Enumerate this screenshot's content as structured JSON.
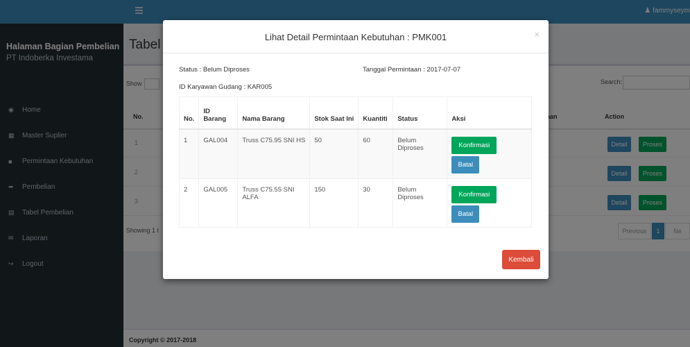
{
  "header": {
    "user": " fammyseym"
  },
  "sidebar": {
    "title": "Halaman Bagian Pembelian",
    "subtitle": "PT Indoberka Investama",
    "items": [
      {
        "label": "Home",
        "icon": "dashboard-icon"
      },
      {
        "label": "Master Suplier",
        "icon": "grid-icon"
      },
      {
        "label": "Permintaan Kebutuhan",
        "icon": "folder-icon"
      },
      {
        "label": "Pembelian",
        "icon": "share-icon"
      },
      {
        "label": "Tabel Pembelian",
        "icon": "table-icon"
      },
      {
        "label": "Laporan",
        "icon": "envelope-icon"
      },
      {
        "label": "Logout",
        "icon": "logout-icon"
      }
    ]
  },
  "content": {
    "page_title": "Tabel P",
    "show_label": "Show",
    "search_label": "Search:",
    "col_no": "No.",
    "col_aan": "aan",
    "col_action": "Action",
    "rows": [
      "1",
      "2",
      "3"
    ],
    "detail_label": "Detail",
    "proses_label": "Proses",
    "showing": "Showing 1 t",
    "prev_label": "Previous",
    "page_1": "1",
    "next_label": "Ne"
  },
  "footer": {
    "text": "Copyright © 2017-2018"
  },
  "modal": {
    "title": "Lihat Detail Permintaan Kebutuhan : PMK001",
    "close": "×",
    "status": "Status : Belum Diproses",
    "date": "Tanggal Permintaan : 2017-07-07",
    "karyawan": "ID Karyawan Gudang : KAR005",
    "columns": [
      "No.",
      "ID Barang",
      "Nama Barang",
      "Stok Saat Ini",
      "Kuantiti",
      "Status",
      "Aksi"
    ],
    "rows": [
      {
        "no": "1",
        "id": "GAL004",
        "nama": "Truss C75.95 SNI HS",
        "stok": "50",
        "kuantiti": "60",
        "status": "Belum Diproses"
      },
      {
        "no": "2",
        "id": "GAL005",
        "nama": "Truss C75.55 SNI ALFA",
        "stok": "150",
        "kuantiti": "30",
        "status": "Belum Diproses"
      }
    ],
    "konfirmasi_label": "Konfirmasi",
    "batal_label": "Batal",
    "kembali_label": "Kembali"
  },
  "colors": {
    "primary": "#3c8dbc",
    "success": "#00a65a",
    "danger": "#dd4b39",
    "sidebar": "#222d32"
  }
}
